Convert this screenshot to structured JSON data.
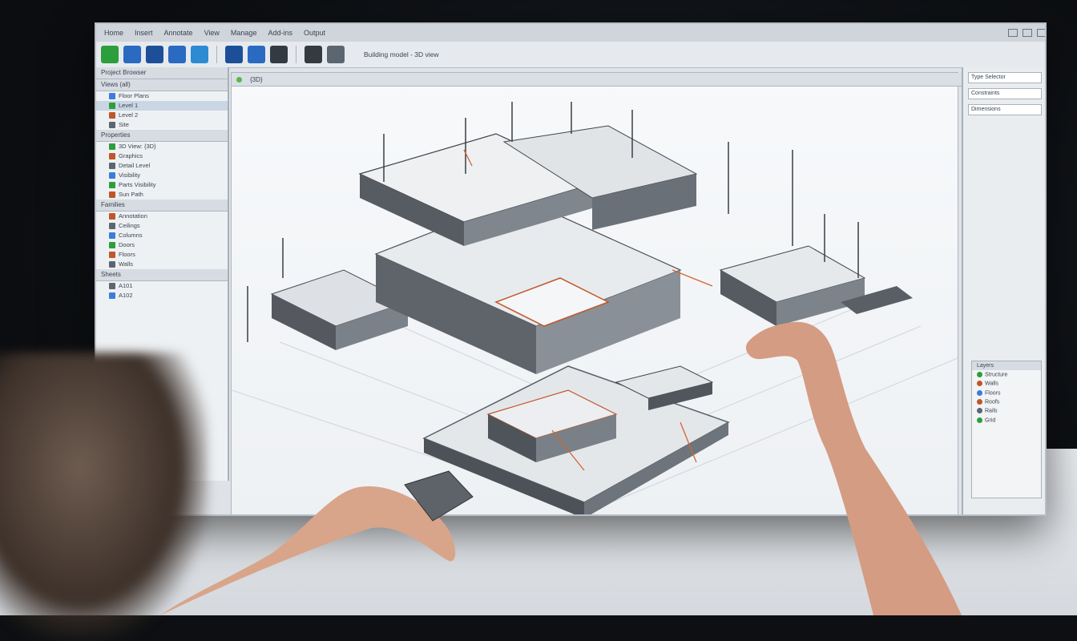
{
  "menubar": {
    "items": [
      "Home",
      "Insert",
      "Annotate",
      "View",
      "Manage",
      "Add-ins",
      "Output"
    ]
  },
  "toolbar": {
    "tools": [
      {
        "icon": "select-icon",
        "color": "#2d9e3c"
      },
      {
        "icon": "wall-icon",
        "color": "#2a6ac1"
      },
      {
        "icon": "door-icon",
        "color": "#1d4f99"
      },
      {
        "icon": "window-icon",
        "color": "#2a6ac1"
      },
      {
        "icon": "column-icon",
        "color": "#2c8bd1"
      },
      {
        "icon": "roof-icon",
        "color": "#1d4f99"
      },
      {
        "icon": "floor-icon",
        "color": "#2a6ac1"
      },
      {
        "icon": "camera-icon",
        "color": "#333a42"
      },
      {
        "icon": "render-icon",
        "color": "#333a42"
      },
      {
        "icon": "settings-icon",
        "color": "#5c6670"
      }
    ],
    "status": "Building model - 3D view"
  },
  "left_panel": {
    "title": "Project Browser",
    "sections": [
      {
        "label": "Views (all)",
        "rows": [
          "Floor Plans",
          "Level 1",
          "Level 2",
          "Site"
        ]
      },
      {
        "label": "Properties",
        "rows": [
          "3D View: {3D}",
          "Graphics",
          "Detail Level",
          "Visibility",
          "Parts Visibility",
          "Sun Path"
        ]
      },
      {
        "label": "Families",
        "rows": [
          "Annotation",
          "Ceilings",
          "Columns",
          "Doors",
          "Floors",
          "Walls"
        ]
      },
      {
        "label": "Sheets",
        "rows": [
          "A101",
          "A102"
        ]
      }
    ]
  },
  "viewport": {
    "tab": "{3D}"
  },
  "right_panel": {
    "fields": [
      "Type Selector",
      "Constraints",
      "Dimensions"
    ],
    "sub_panel": {
      "title": "Layers",
      "rows": [
        "Structure",
        "Walls",
        "Floors",
        "Roofs",
        "Rails",
        "Grid"
      ]
    }
  }
}
